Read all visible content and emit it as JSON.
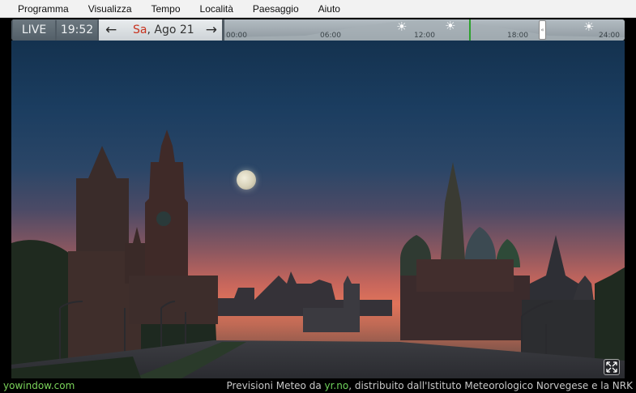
{
  "menu": {
    "items": [
      "Programma",
      "Visualizza",
      "Tempo",
      "Località",
      "Paesaggio",
      "Aiuto"
    ]
  },
  "timebar": {
    "live_label": "LIVE",
    "clock": "19:52",
    "prev_arrow": "←",
    "next_arrow": "→",
    "day": "Sa",
    "date_rest": ", Ago 21",
    "ticks": [
      "00:00",
      "06:00",
      "12:00",
      "18:00",
      "24:00"
    ],
    "handle_glyph": "«",
    "weather_icons": [
      "sun-cloud-icon",
      "sun-icon",
      "sun-cloud-icon"
    ]
  },
  "status": {
    "brand": "yowindow.com",
    "credits_prefix": "Previsioni Meteo da ",
    "credits_link": "yr.no",
    "credits_suffix": ", distribuito dall'Istituto Meteorologico Norvegese e la NRK"
  },
  "colors": {
    "accent_green": "#2ea12e",
    "day_red": "#c8321e",
    "link_green": "#6fd35c"
  }
}
